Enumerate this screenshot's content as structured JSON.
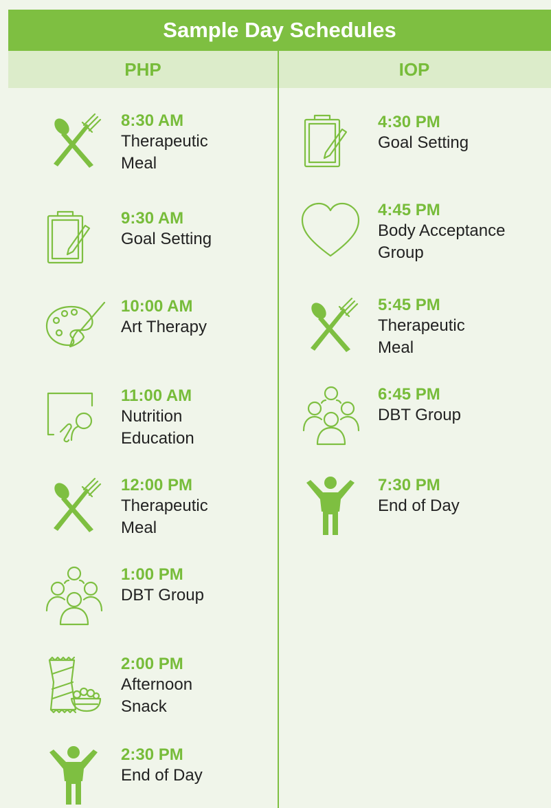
{
  "title": "Sample Day Schedules",
  "colors": {
    "accent": "#7ebf41",
    "band": "#dcecca",
    "background": "#f0f5ea"
  },
  "columns": [
    {
      "label": "PHP",
      "items": [
        {
          "icon": "utensils-icon",
          "time": "8:30 AM",
          "label": "Therapeutic\nMeal"
        },
        {
          "icon": "clipboard-icon",
          "time": "9:30 AM",
          "label": "Goal Setting"
        },
        {
          "icon": "palette-icon",
          "time": "10:00 AM",
          "label": "Art Therapy"
        },
        {
          "icon": "presentation-icon",
          "time": "11:00 AM",
          "label": "Nutrition\nEducation"
        },
        {
          "icon": "utensils-icon",
          "time": "12:00 PM",
          "label": "Therapeutic\nMeal"
        },
        {
          "icon": "group-icon",
          "time": "1:00 PM",
          "label": "DBT Group"
        },
        {
          "icon": "snack-icon",
          "time": "2:00 PM",
          "label": "Afternoon\nSnack"
        },
        {
          "icon": "person-icon",
          "time": "2:30 PM",
          "label": "End of Day"
        }
      ]
    },
    {
      "label": "IOP",
      "items": [
        {
          "icon": "clipboard-icon",
          "time": "4:30 PM",
          "label": "Goal Setting"
        },
        {
          "icon": "heart-icon",
          "time": "4:45 PM",
          "label": "Body Acceptance\nGroup"
        },
        {
          "icon": "utensils-icon",
          "time": "5:45 PM",
          "label": "Therapeutic\nMeal"
        },
        {
          "icon": "group-icon",
          "time": "6:45 PM",
          "label": "DBT Group"
        },
        {
          "icon": "person-icon",
          "time": "7:30 PM",
          "label": "End of Day"
        }
      ]
    }
  ]
}
